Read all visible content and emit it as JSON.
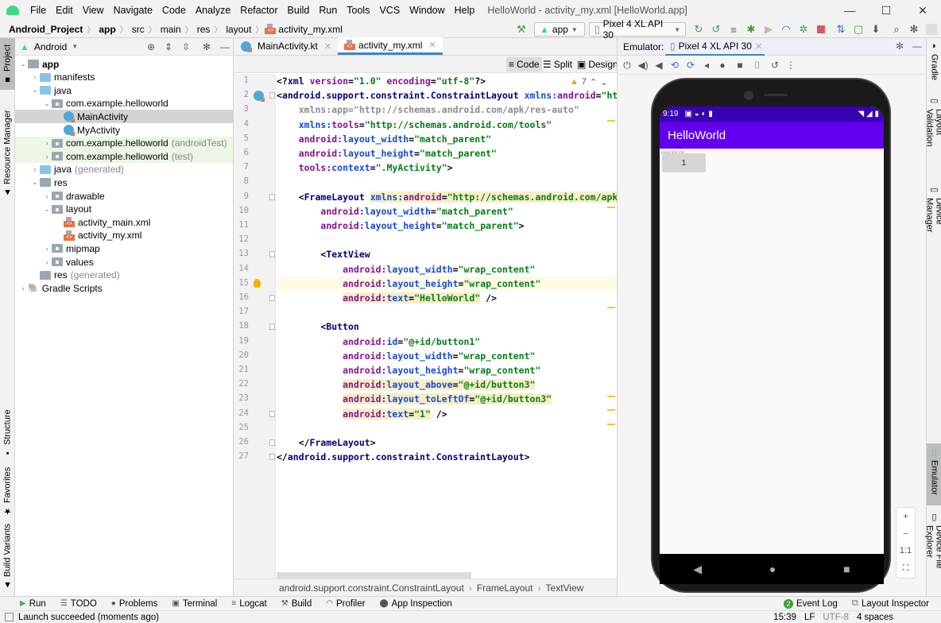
{
  "window": {
    "title": "HelloWorld - activity_my.xml [HelloWorld.app]",
    "menu": [
      "File",
      "Edit",
      "View",
      "Navigate",
      "Code",
      "Analyze",
      "Refactor",
      "Build",
      "Run",
      "Tools",
      "VCS",
      "Window",
      "Help"
    ],
    "controls": {
      "minimize": "—",
      "maximize": "☐",
      "close": "✕"
    }
  },
  "navbar": {
    "breadcrumb": [
      "Android_Project",
      "app",
      "src",
      "main",
      "res",
      "layout",
      "activity_my.xml"
    ],
    "run_config": "app",
    "device": "Pixel 4 XL API 30"
  },
  "left_stripe": {
    "top": [
      {
        "label": "Project",
        "icon": "folder-icon",
        "active": true
      },
      {
        "label": "Resource Manager",
        "icon": "resource-icon",
        "active": false
      }
    ],
    "bottom": [
      {
        "label": "Structure",
        "icon": "structure-icon"
      },
      {
        "label": "Favorites",
        "icon": "star-icon"
      },
      {
        "label": "Build Variants",
        "icon": "android-icon"
      }
    ]
  },
  "project": {
    "view_selector": "Android",
    "tree": [
      {
        "label": "app",
        "suffix": "",
        "depth": 0,
        "expanded": true,
        "icon": "module-folder",
        "bold": true
      },
      {
        "label": "manifests",
        "suffix": "",
        "depth": 1,
        "expanded": false,
        "icon": "folder-blue"
      },
      {
        "label": "java",
        "suffix": "",
        "depth": 1,
        "expanded": true,
        "icon": "folder-blue"
      },
      {
        "label": "com.example.helloworld",
        "suffix": "",
        "depth": 2,
        "expanded": true,
        "icon": "package"
      },
      {
        "label": "MainActivity",
        "suffix": "",
        "depth": 3,
        "icon": "kotlin-class",
        "selected": true
      },
      {
        "label": "MyActivity",
        "suffix": "",
        "depth": 3,
        "icon": "kotlin-class"
      },
      {
        "label": "com.example.helloworld",
        "suffix": "(androidTest)",
        "depth": 2,
        "expanded": false,
        "icon": "package",
        "test": true
      },
      {
        "label": "com.example.helloworld",
        "suffix": "(test)",
        "depth": 2,
        "expanded": false,
        "icon": "package",
        "test": true
      },
      {
        "label": "java",
        "suffix": "(generated)",
        "depth": 1,
        "expanded": false,
        "icon": "folder-blue"
      },
      {
        "label": "res",
        "suffix": "",
        "depth": 1,
        "expanded": true,
        "icon": "res-folder"
      },
      {
        "label": "drawable",
        "suffix": "",
        "depth": 2,
        "expanded": false,
        "icon": "package"
      },
      {
        "label": "layout",
        "suffix": "",
        "depth": 2,
        "expanded": true,
        "icon": "package"
      },
      {
        "label": "activity_main.xml",
        "suffix": "",
        "depth": 3,
        "icon": "xml-file"
      },
      {
        "label": "activity_my.xml",
        "suffix": "",
        "depth": 3,
        "icon": "xml-file"
      },
      {
        "label": "mipmap",
        "suffix": "",
        "depth": 2,
        "expanded": false,
        "icon": "package"
      },
      {
        "label": "values",
        "suffix": "",
        "depth": 2,
        "expanded": false,
        "icon": "package"
      },
      {
        "label": "res",
        "suffix": "(generated)",
        "depth": 1,
        "icon": "res-folder"
      },
      {
        "label": "Gradle Scripts",
        "suffix": "",
        "depth": 0,
        "expanded": false,
        "icon": "gradle"
      }
    ]
  },
  "editor": {
    "tabs": [
      {
        "label": "MainActivity.kt",
        "active": false
      },
      {
        "label": "activity_my.xml",
        "active": true
      }
    ],
    "view_modes": [
      "Code",
      "Split",
      "Design"
    ],
    "warnings_count": "7",
    "lines": [
      [
        [
          "pun",
          "<?"
        ],
        [
          "tag",
          "xml "
        ],
        [
          "attr",
          "version"
        ],
        [
          "pun",
          "="
        ],
        [
          "val",
          "\"1.0\" "
        ],
        [
          "attr",
          "encoding"
        ],
        [
          "pun",
          "="
        ],
        [
          "val",
          "\"utf-8\""
        ],
        [
          "pun",
          "?>"
        ]
      ],
      [
        [
          "pun",
          "<"
        ],
        [
          "tag",
          "android.support.constraint.ConstraintLayout "
        ],
        [
          "ns",
          "xmlns:"
        ],
        [
          "attr",
          "android"
        ],
        [
          "pun",
          "="
        ],
        [
          "val",
          "\"http"
        ]
      ],
      [
        [
          "pun",
          "    "
        ],
        [
          "gray",
          "xmlns:app=\"http://schemas.android.com/apk/res-auto\""
        ]
      ],
      [
        [
          "pun",
          "    "
        ],
        [
          "ns",
          "xmlns:"
        ],
        [
          "attr",
          "tools"
        ],
        [
          "pun",
          "="
        ],
        [
          "val",
          "\"http://schemas.android.com/tools\""
        ]
      ],
      [
        [
          "pun",
          "    "
        ],
        [
          "attr",
          "android:"
        ],
        [
          "ns",
          "layout_width"
        ],
        [
          "pun",
          "="
        ],
        [
          "val",
          "\"match_parent\""
        ]
      ],
      [
        [
          "pun",
          "    "
        ],
        [
          "attr",
          "android:"
        ],
        [
          "ns",
          "layout_height"
        ],
        [
          "pun",
          "="
        ],
        [
          "val",
          "\"match_parent\""
        ]
      ],
      [
        [
          "pun",
          "    "
        ],
        [
          "attr",
          "tools:"
        ],
        [
          "ns",
          "context"
        ],
        [
          "pun",
          "="
        ],
        [
          "val",
          "\".MyActivity\""
        ],
        [
          "pun",
          ">"
        ]
      ],
      [],
      [
        [
          "pun",
          "    <"
        ],
        [
          "tag",
          "FrameLayout "
        ],
        [
          "wsns",
          "xmlns:"
        ],
        [
          "wsattr",
          "android"
        ],
        [
          "wspun",
          "="
        ],
        [
          "wsval",
          "\"http://schemas.android.com/apk/re"
        ]
      ],
      [
        [
          "pun",
          "        "
        ],
        [
          "attr",
          "android:"
        ],
        [
          "ns",
          "layout_width"
        ],
        [
          "pun",
          "="
        ],
        [
          "val",
          "\"match_parent\""
        ]
      ],
      [
        [
          "pun",
          "        "
        ],
        [
          "attr",
          "android:"
        ],
        [
          "ns",
          "layout_height"
        ],
        [
          "pun",
          "="
        ],
        [
          "val",
          "\"match_parent\""
        ],
        [
          "pun",
          ">"
        ]
      ],
      [],
      [
        [
          "pun",
          "        <"
        ],
        [
          "tag",
          "TextView"
        ]
      ],
      [
        [
          "pun",
          "            "
        ],
        [
          "attr",
          "android:"
        ],
        [
          "ns",
          "layout_width"
        ],
        [
          "pun",
          "="
        ],
        [
          "val",
          "\"wrap_content\""
        ]
      ],
      [
        [
          "pun",
          "            "
        ],
        [
          "attr",
          "android:"
        ],
        [
          "ns",
          "layout_height"
        ],
        [
          "pun",
          "="
        ],
        [
          "val",
          "\"wrap_content\""
        ]
      ],
      [
        [
          "pun",
          "            "
        ],
        [
          "wsattr",
          "android:"
        ],
        [
          "wsns",
          "text"
        ],
        [
          "wspun",
          "="
        ],
        [
          "wsval",
          "\"HelloWorld\""
        ],
        [
          "pun",
          " />"
        ]
      ],
      [],
      [
        [
          "pun",
          "        <"
        ],
        [
          "tag",
          "Button"
        ]
      ],
      [
        [
          "pun",
          "            "
        ],
        [
          "attr",
          "android:"
        ],
        [
          "ns",
          "id"
        ],
        [
          "pun",
          "="
        ],
        [
          "val",
          "\"@+id/button1\""
        ]
      ],
      [
        [
          "pun",
          "            "
        ],
        [
          "attr",
          "android:"
        ],
        [
          "ns",
          "layout_width"
        ],
        [
          "pun",
          "="
        ],
        [
          "val",
          "\"wrap_content\""
        ]
      ],
      [
        [
          "pun",
          "            "
        ],
        [
          "attr",
          "android:"
        ],
        [
          "ns",
          "layout_height"
        ],
        [
          "pun",
          "="
        ],
        [
          "val",
          "\"wrap_content\""
        ]
      ],
      [
        [
          "pun",
          "            "
        ],
        [
          "wsattr",
          "android:"
        ],
        [
          "wsns",
          "layout_above"
        ],
        [
          "wspun",
          "="
        ],
        [
          "wsval",
          "\"@+id/button3\""
        ]
      ],
      [
        [
          "pun",
          "            "
        ],
        [
          "wsattr",
          "android:"
        ],
        [
          "wsns",
          "layout_toLeftOf"
        ],
        [
          "wspun",
          "="
        ],
        [
          "wsval",
          "\"@+id/button3\""
        ]
      ],
      [
        [
          "pun",
          "            "
        ],
        [
          "wsattr",
          "android:"
        ],
        [
          "wsns",
          "text"
        ],
        [
          "wspun",
          "="
        ],
        [
          "wsval",
          "\"1\""
        ],
        [
          "pun",
          " />"
        ]
      ],
      [],
      [
        [
          "pun",
          "    </"
        ],
        [
          "tag",
          "FrameLayout"
        ],
        [
          "pun",
          ">"
        ]
      ],
      [
        [
          "pun",
          "</"
        ],
        [
          "tag",
          "android.support.constraint.ConstraintLayout"
        ],
        [
          "pun",
          ">"
        ]
      ]
    ],
    "breadcrumb": [
      "android.support.constraint.ConstraintLayout",
      "FrameLayout",
      "TextView"
    ]
  },
  "emulator": {
    "label": "Emulator:",
    "tab": "Pixel 4 XL API 30",
    "phone": {
      "time": "9:19",
      "app_title": "HelloWorld",
      "button_text": "1",
      "colors": {
        "status": "#3700b3",
        "appbar": "#6200ee"
      }
    },
    "zoom_controls": [
      "+",
      "−",
      "1:1",
      "⛶"
    ]
  },
  "right_stripe": [
    {
      "label": "Gradle",
      "icon": "gradle-icon"
    },
    {
      "label": "Layout Validation",
      "icon": "layout-validation-icon"
    },
    {
      "label": "Device Manager",
      "icon": "device-manager-icon"
    },
    {
      "label": "Emulator",
      "icon": "emulator-icon",
      "active": true
    },
    {
      "label": "Device File Explorer",
      "icon": "device-file-icon"
    }
  ],
  "bottom_tools": [
    {
      "label": "Run",
      "icon": "run-icon"
    },
    {
      "label": "TODO",
      "icon": "todo-icon"
    },
    {
      "label": "Problems",
      "icon": "problems-icon"
    },
    {
      "label": "Terminal",
      "icon": "terminal-icon"
    },
    {
      "label": "Logcat",
      "icon": "logcat-icon"
    },
    {
      "label": "Build",
      "icon": "build-icon"
    },
    {
      "label": "Profiler",
      "icon": "profiler-icon"
    },
    {
      "label": "App Inspection",
      "icon": "app-inspection-icon"
    }
  ],
  "bottom_right_tools": [
    {
      "label": "Event Log",
      "badge": "2"
    },
    {
      "label": "Layout Inspector"
    }
  ],
  "status": {
    "message": "Launch succeeded (moments ago)",
    "position": "15:39",
    "line_sep": "LF",
    "encoding": "UTF-8",
    "indent": "4 spaces"
  }
}
